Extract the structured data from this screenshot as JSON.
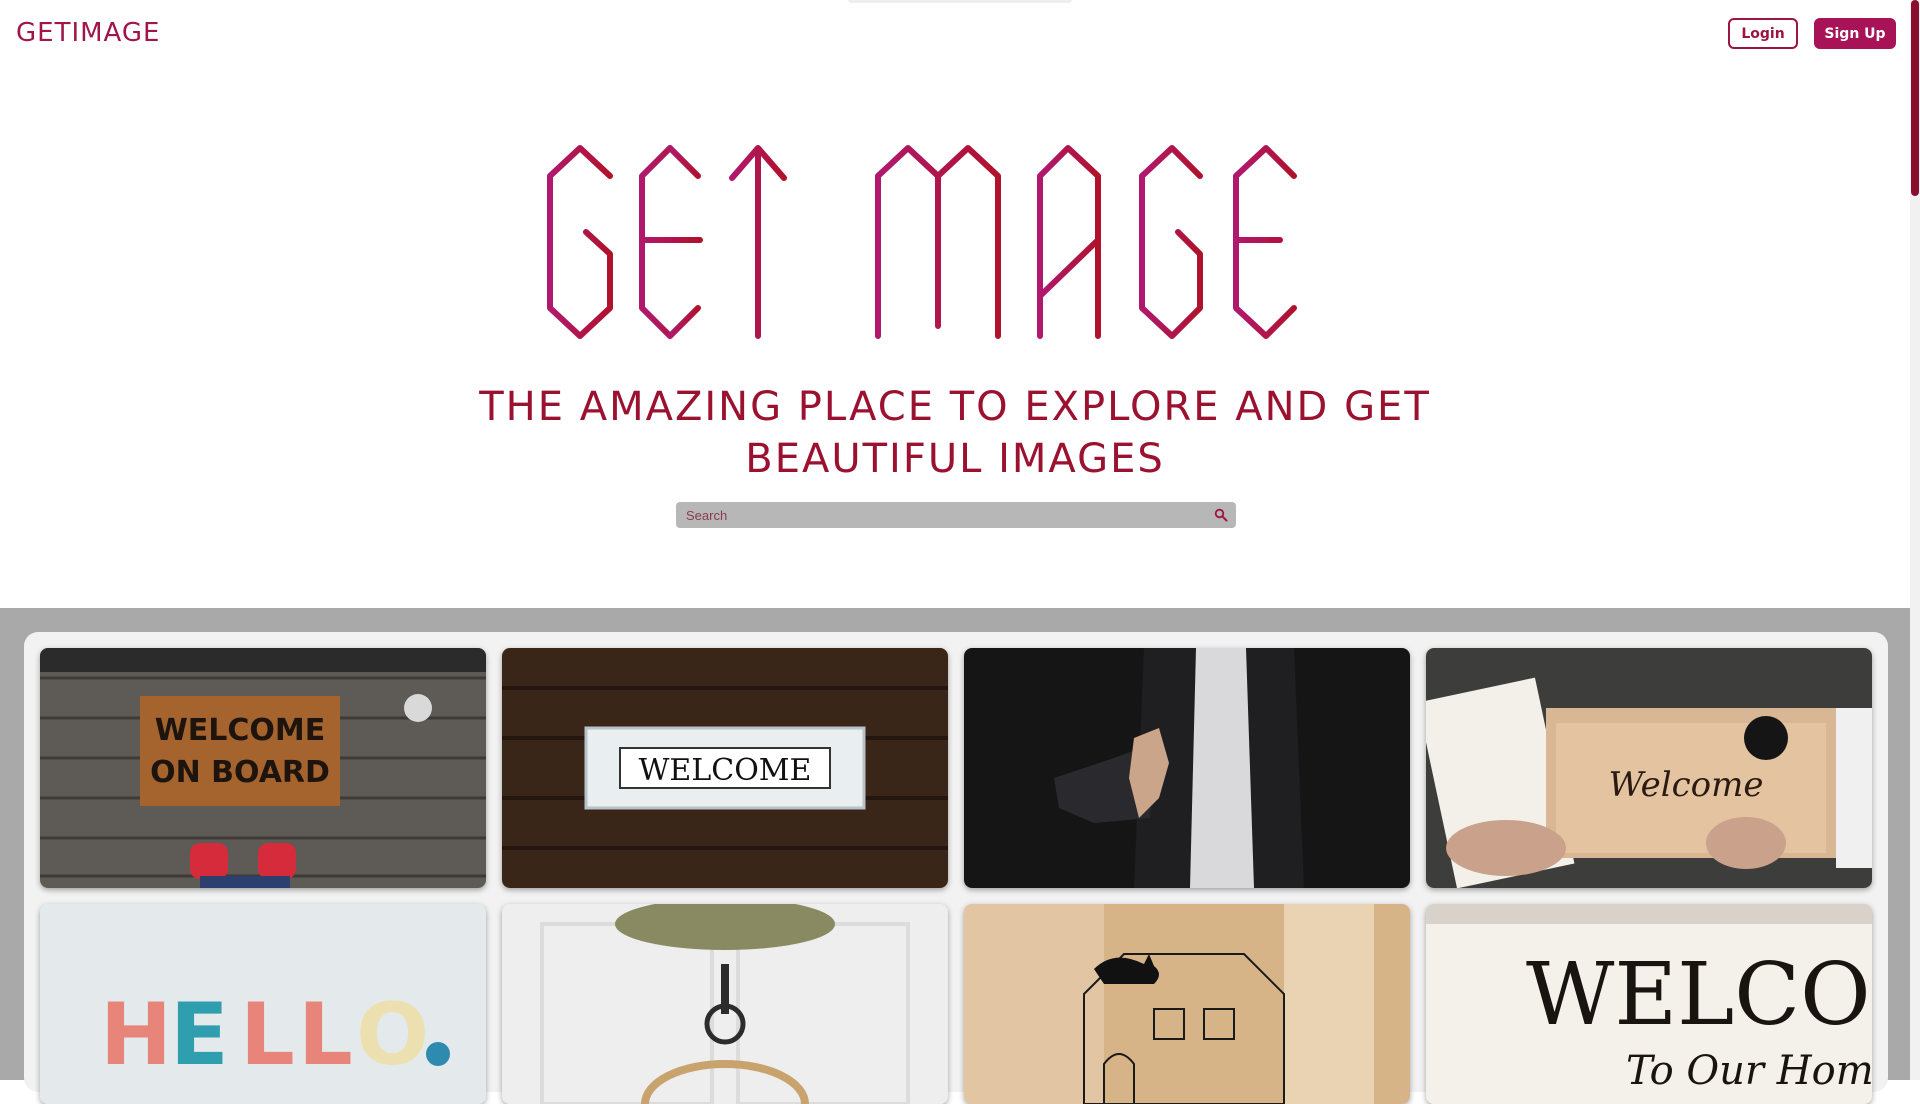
{
  "app": {
    "brand": "GETIMAGE",
    "accent_color": "#a81257",
    "text_color": "#9b1230"
  },
  "header": {
    "login_label": "Login",
    "signup_label": "Sign Up"
  },
  "hero": {
    "logo_text": "GETIMAGE",
    "tagline": "THE AMAZING PLACE TO EXPLORE AND GET BEAUTIFUL IMAGES",
    "search": {
      "placeholder": "Search",
      "value": "",
      "icon": "search-icon"
    }
  },
  "gallery": {
    "images": [
      {
        "subject": "welcome-doormat",
        "text": "WELCOME ON BOARD"
      },
      {
        "subject": "welcome-sign-wood",
        "text": "WELCOME"
      },
      {
        "subject": "handshake-offer",
        "text": ""
      },
      {
        "subject": "welcome-calligraphy",
        "text": "Welcome"
      },
      {
        "subject": "hello-clay-letters",
        "text": "HELLO"
      },
      {
        "subject": "white-door-wreath",
        "text": ""
      },
      {
        "subject": "cat-house-drawing",
        "text": ""
      },
      {
        "subject": "welcome-to-our-home-sign",
        "text": "WELCOME To Our Home"
      }
    ]
  }
}
